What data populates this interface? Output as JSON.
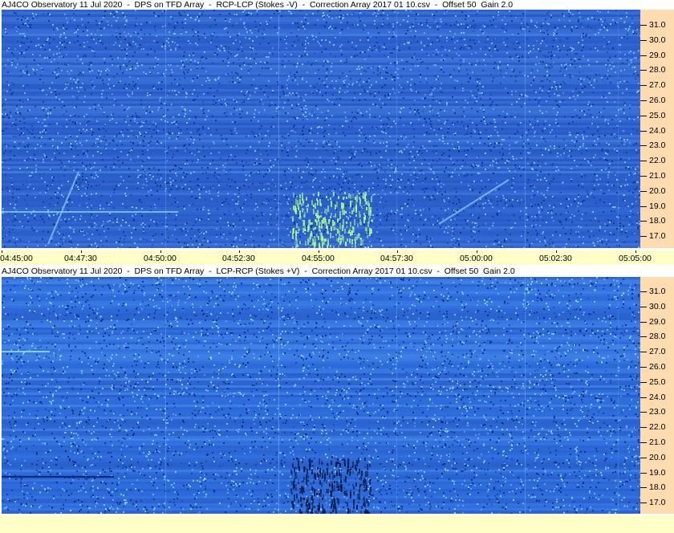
{
  "panels": [
    {
      "title": "AJ4CO Observatory 11 Jul 2020  -  DPS on TFD Array  -  RCP-LCP (Stokes -V)  -  Correction Array 2017 01 10.csv  -  Offset 50  Gain 2.0",
      "base_color": "#2f64d2",
      "bright_color": "#8fd8ff",
      "dark_color": "#0d2a86",
      "burst_color": "#b4ff88"
    },
    {
      "title": "AJ4CO Observatory 11 Jul 2020  -  DPS on TFD Array  -  LCP-RCP (Stokes +V)  -  Correction Array 2017 01 10.csv  -  Offset 50  Gain 2.0",
      "base_color": "#2f6fe0",
      "bright_color": "#9fe2ff",
      "dark_color": "#0b1f70",
      "burst_color": "#0a1540"
    }
  ],
  "freq_axis_mhz": [
    "31.0",
    "30.0",
    "29.0",
    "28.0",
    "27.0",
    "26.0",
    "25.0",
    "24.0",
    "23.0",
    "22.0",
    "21.0",
    "20.0",
    "19.0",
    "18.0",
    "17.0"
  ],
  "time_axis": [
    "04:45:00",
    "04:47:30",
    "04:50:00",
    "04:52:30",
    "04:55:00",
    "04:57:30",
    "05:00:00",
    "05:02:30",
    "05:05:00"
  ],
  "colors": {
    "freq_axis_bg": "#ffdcb0",
    "time_axis_bg": "#ffffc8"
  }
}
